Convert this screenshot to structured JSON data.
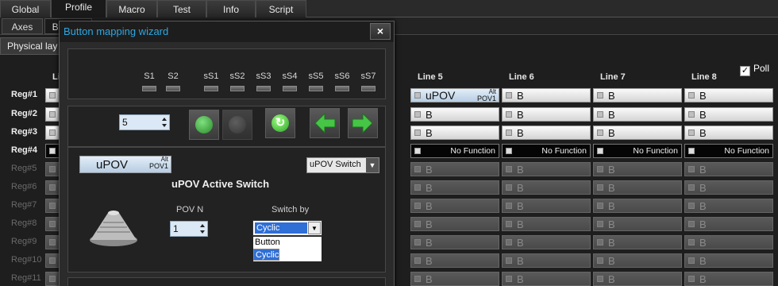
{
  "top_tabs": [
    "Global",
    "Profile",
    "Macro",
    "Test",
    "Info",
    "Script"
  ],
  "sub_tabs": [
    "Axes",
    "Buttons"
  ],
  "physical_layout_label": "Physical lay",
  "poll_label": "Poll",
  "line_headers": [
    "Li",
    "Line 5",
    "Line 6",
    "Line 7",
    "Line 8"
  ],
  "rows": [
    "Reg#1",
    "Reg#2",
    "Reg#3",
    "Reg#4",
    "Reg#5",
    "Reg#6",
    "Reg#7",
    "Reg#8",
    "Reg#9",
    "Reg#10",
    "Reg#11"
  ],
  "cell_text": {
    "b": "B",
    "no_function": "No Function",
    "upov": "uPOV",
    "alt": "Alt",
    "pov1": "POV1"
  },
  "dialog": {
    "title": "Button mapping wizard",
    "close": "×",
    "shift_labels": [
      "S1",
      "S2",
      "sS1",
      "sS2",
      "sS3",
      "sS4",
      "sS5",
      "sS6",
      "sS7"
    ],
    "count_value": "5",
    "mode_badge": {
      "text": "uPOV",
      "alt": "Alt",
      "pov": "POV1"
    },
    "mode_select": "uPOV Switch",
    "section_title": "uPOV Active Switch",
    "pov_n_label": "POV N",
    "pov_n_value": "1",
    "switch_by_label": "Switch by",
    "switch_by_value": "Cyclic",
    "switch_options": [
      "Button",
      "Cyclic"
    ]
  },
  "colors": {
    "title_blue": "#2ea7e0",
    "select_blue": "#2f6fd6",
    "green_btn": "#3fbf3f"
  }
}
